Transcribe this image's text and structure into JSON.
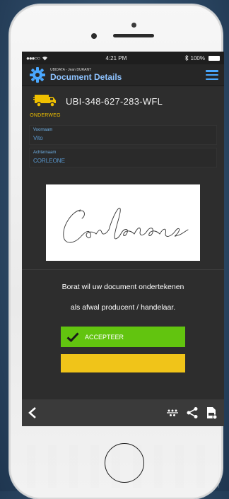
{
  "status_bar": {
    "signal": "●●●○○",
    "time": "4:21 PM",
    "battery": "100%"
  },
  "header": {
    "subtitle": "UBIDATA - Jean DURANT",
    "title": "Document Details"
  },
  "document": {
    "status": "ONDERWEG",
    "id": "UBI-348-627-283-WFL"
  },
  "fields": [
    {
      "label": "Voornaam",
      "value": "Vito"
    },
    {
      "label": "Achternaam",
      "value": "CORLEONE"
    }
  ],
  "signature": {
    "image": "signature-corleone"
  },
  "message": {
    "line1": "Borat wil uw document ondertekenen",
    "line2": "als afwal producent / handelaar."
  },
  "buttons": {
    "accept": "ACCEPTEER"
  },
  "bottom_bar": {
    "icons": [
      "back-icon",
      "route-icon",
      "share-icon",
      "pdf-icon"
    ]
  },
  "colors": {
    "accent_blue": "#4aa8ff",
    "status_yellow": "#f0c000",
    "accept_green": "#62c40f",
    "screen_bg": "#2d2d2d"
  }
}
